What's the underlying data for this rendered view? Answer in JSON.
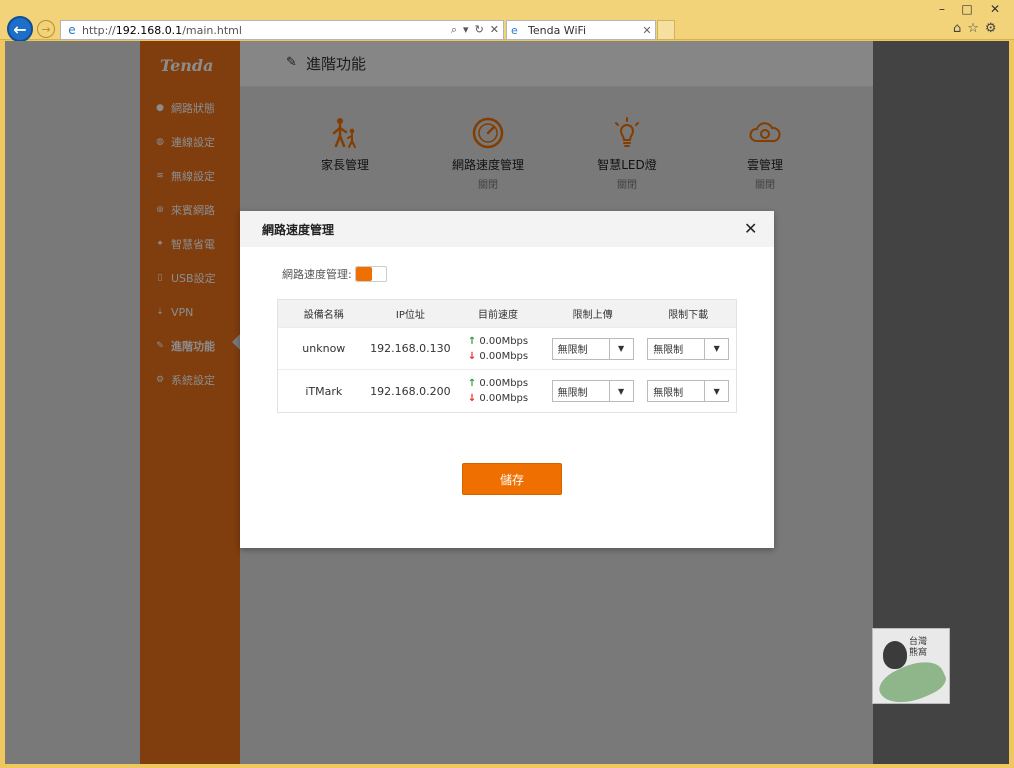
{
  "browser": {
    "url_prefix": "http://",
    "url": "192.168.0.1",
    "url_suffix": "/main.html",
    "tab_title": "Tenda WiFi",
    "window_controls": {
      "minimize": "–",
      "maximize": "□",
      "close": "✕"
    },
    "icons": [
      "back-icon",
      "forward-icon",
      "search-icon",
      "refresh-icon",
      "home-icon",
      "favorites-icon",
      "settings-icon"
    ]
  },
  "sidebar": {
    "logo": "Tenda",
    "items": [
      {
        "label": "網路狀態",
        "icon": "person-icon",
        "glyph": "●"
      },
      {
        "label": "連線設定",
        "icon": "globe-icon",
        "glyph": "◍"
      },
      {
        "label": "無線設定",
        "icon": "wifi-icon",
        "glyph": "≋"
      },
      {
        "label": "來賓網路",
        "icon": "guest-icon",
        "glyph": "⊛"
      },
      {
        "label": "智慧省電",
        "icon": "bulb-icon",
        "glyph": "✦"
      },
      {
        "label": "USB設定",
        "icon": "usb-icon",
        "glyph": "▯"
      },
      {
        "label": "VPN",
        "icon": "vpn-icon",
        "glyph": "⇣"
      },
      {
        "label": "進階功能",
        "icon": "wrench-icon",
        "glyph": "✎",
        "active": true
      },
      {
        "label": "系統設定",
        "icon": "gear-icon",
        "glyph": "⚙"
      }
    ]
  },
  "header": {
    "title": "進階功能"
  },
  "features": [
    {
      "label": "家長管理",
      "sub": ""
    },
    {
      "label": "網路速度管理",
      "sub": "關閉"
    },
    {
      "label": "智慧LED燈",
      "sub": "關閉"
    },
    {
      "label": "雲管理",
      "sub": "關閉"
    }
  ],
  "modal": {
    "title": "網路速度管理",
    "close": "✕",
    "toggle_label": "網路速度管理:",
    "toggle_on": true,
    "columns": [
      "設備名稱",
      "IP位址",
      "目前速度",
      "限制上傳",
      "限制下載"
    ],
    "rows": [
      {
        "device": "unknow",
        "ip": "192.168.0.130",
        "up": "0.00Mbps",
        "down": "0.00Mbps",
        "upload_limit": "無限制",
        "download_limit": "無限制"
      },
      {
        "device": "iTMark",
        "ip": "192.168.0.200",
        "up": "0.00Mbps",
        "down": "0.00Mbps",
        "upload_limit": "無限制",
        "download_limit": "無限制"
      }
    ],
    "save_label": "儲存"
  },
  "colors": {
    "accent": "#ef6f00",
    "sidebar": "#e9701a",
    "up": "#3a9a3a",
    "down": "#e0302b"
  }
}
